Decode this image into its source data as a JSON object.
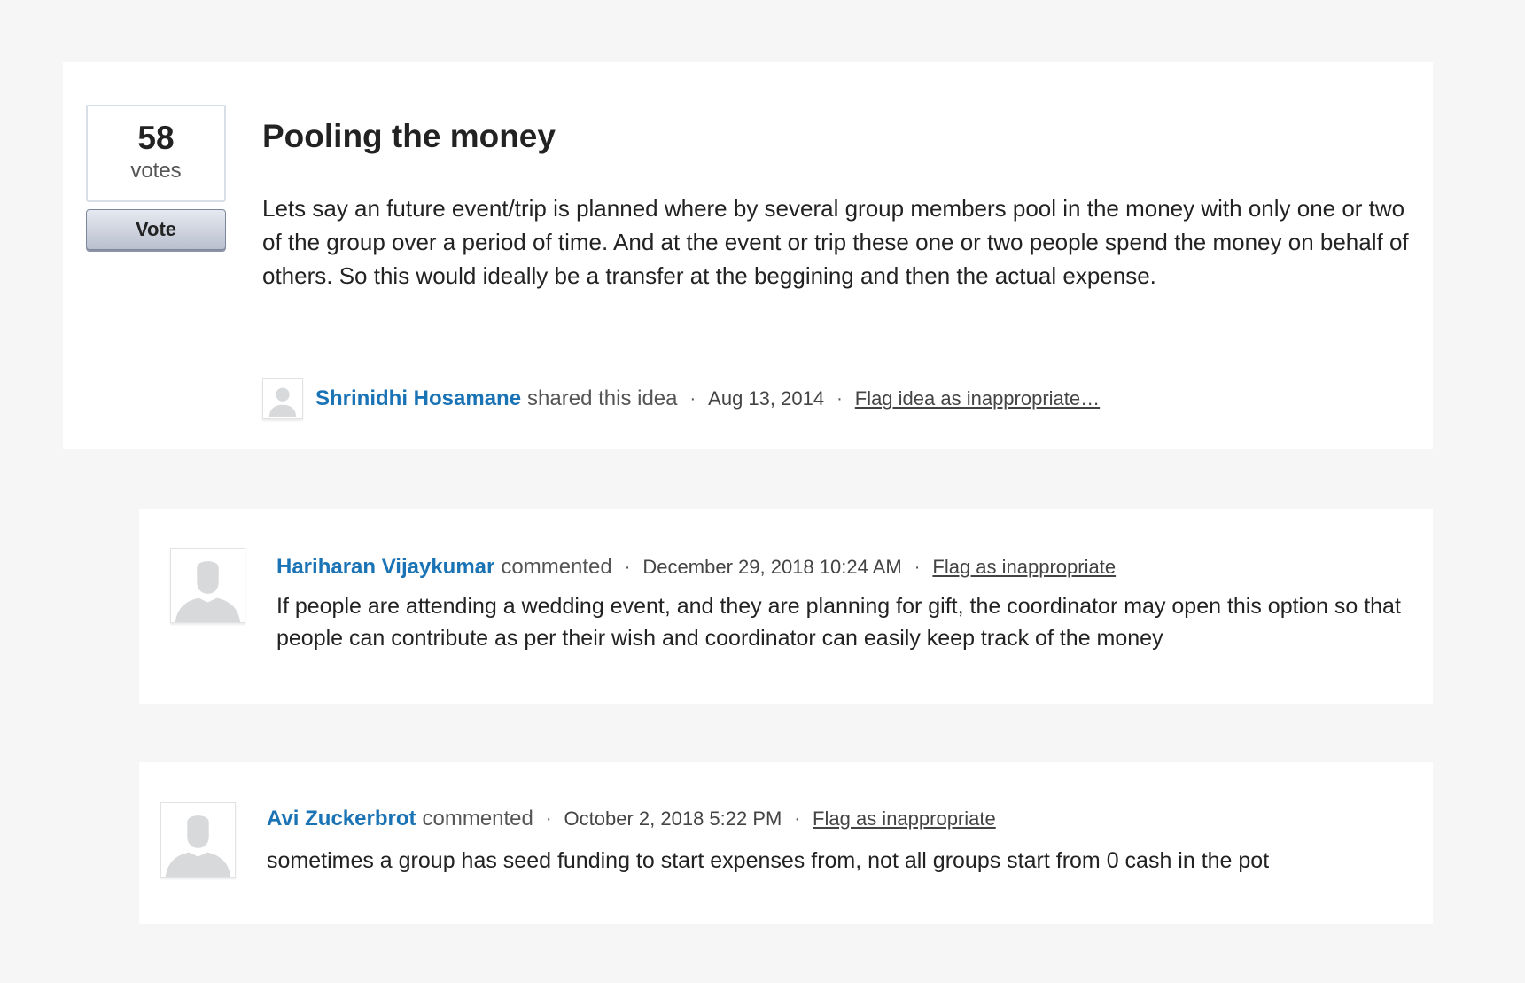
{
  "idea": {
    "votes": "58",
    "votes_unit": "votes",
    "vote_button_label": "Vote",
    "title": "Pooling the money",
    "body": "Lets say an future event/trip is planned where by several group members pool in the money with only one or two of the group over a period of time. And at the event or trip these one or two people spend the money on behalf of others. So this would ideally be a transfer at the beggining and then the actual expense.",
    "author": "Shrinidhi Hosamane",
    "action": "shared this idea",
    "separator": "·",
    "date": "Aug 13, 2014",
    "flag_label": "Flag idea as inappropriate…"
  },
  "comments": [
    {
      "author": "Hariharan Vijaykumar",
      "action": "commented",
      "separator": "·",
      "date": "December 29, 2018 10:24 AM",
      "flag_label": "Flag as inappropriate",
      "text": "If people are attending a wedding event, and they are planning for gift, the coordinator may open this option so that people can contribute as per their wish and coordinator can easily keep track of the money"
    },
    {
      "author": "Avi Zuckerbrot",
      "action": "commented",
      "separator": "·",
      "date": "October 2, 2018 5:22 PM",
      "flag_label": "Flag as inappropriate",
      "text": "sometimes a group has seed funding to start expenses from, not all groups start from 0 cash in the pot"
    }
  ],
  "icons": {
    "avatar": "user-silhouette-icon"
  },
  "colors": {
    "author_link": "#1a73b5",
    "page_background": "#f6f6f6",
    "card_background": "#ffffff"
  }
}
